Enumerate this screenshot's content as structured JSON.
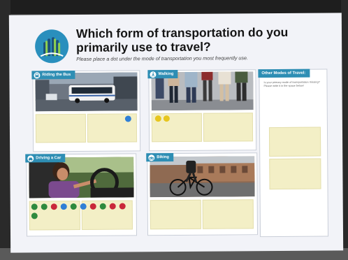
{
  "poster": {
    "title": "Which form of transportation do you primarily use to travel?",
    "subtitle": "Please place a dot under the mode of transportation you most frequently use."
  },
  "cards": {
    "bus": {
      "label": "Riding the Bus",
      "icon": "bus-icon",
      "dots": [
        "blue"
      ]
    },
    "walking": {
      "label": "Walking",
      "icon": "walking-icon",
      "dots": [
        "yellow",
        "yellow"
      ]
    },
    "car": {
      "label": "Driving a Car",
      "icon": "car-icon",
      "dots": [
        "green",
        "green",
        "red",
        "blue",
        "green",
        "blue",
        "red",
        "green",
        "red",
        "red",
        "green"
      ]
    },
    "biking": {
      "label": "Biking",
      "icon": "bicycle-icon",
      "dots": []
    },
    "other": {
      "label": "Other Modes of Travel:",
      "description": "Is your primary mode of transportation missing? Please write it in the space below!"
    }
  },
  "colors": {
    "accent": "#2e8eb4",
    "note": "#f3efc6",
    "blue": "#2f7fd6",
    "yellow": "#e7c61f",
    "green": "#2e8a3e",
    "red": "#c9283a"
  }
}
